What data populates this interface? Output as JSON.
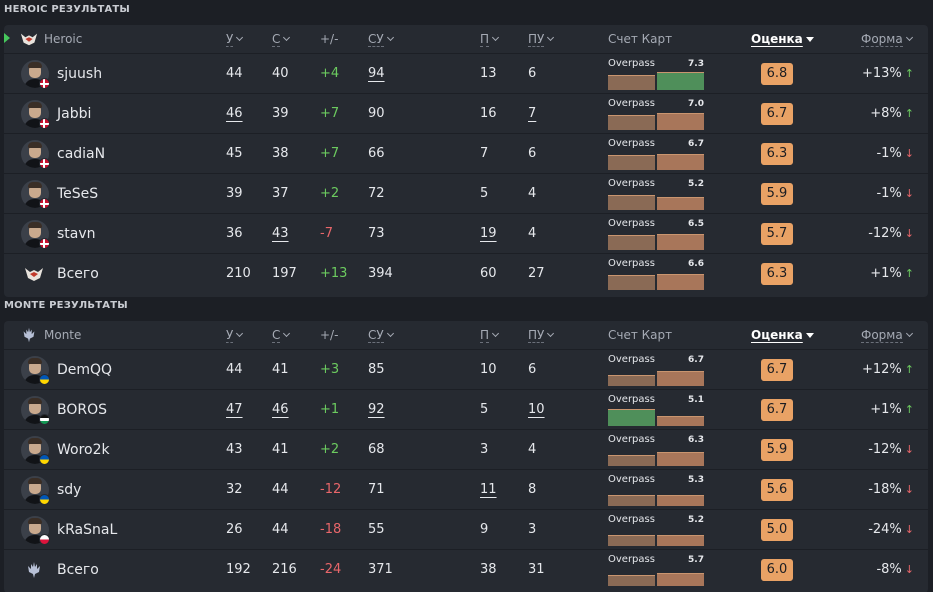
{
  "sections": [
    {
      "title": "HEROIC РЕЗУЛЬТАТЫ",
      "team": "Heroic",
      "team_logo_icon": "heroic-wings-icon",
      "team_logo_color": "#e8e3dd",
      "selected": true,
      "columns": {
        "kills": "У",
        "deaths": "С",
        "diff": "+/-",
        "adr": "СУ",
        "fk": "П",
        "fd": "ПУ",
        "map_score": "Счет Карт",
        "rating": "Оценка",
        "form": "Форма"
      },
      "rows": [
        {
          "name": "sjuush",
          "flag": "dk",
          "kills": "44",
          "deaths": "40",
          "diff": "+4",
          "adr": "94",
          "fk": "13",
          "fd": "6",
          "map": "Overpass",
          "map_rating": "7.3",
          "map_fill": 0.85,
          "map_rating_fill": 1.0,
          "map_highlight": true,
          "rating": "6.8",
          "form": "+13%",
          "trend": "up",
          "underline": [
            "adr"
          ]
        },
        {
          "name": "Jabbi",
          "flag": "dk",
          "kills": "46",
          "deaths": "39",
          "diff": "+7",
          "adr": "90",
          "fk": "16",
          "fd": "7",
          "map": "Overpass",
          "map_rating": "7.0",
          "map_fill": 0.85,
          "map_rating_fill": 0.95,
          "map_highlight": false,
          "rating": "6.7",
          "form": "+8%",
          "trend": "up",
          "underline": [
            "kills",
            "fd"
          ]
        },
        {
          "name": "cadiaN",
          "flag": "dk",
          "kills": "45",
          "deaths": "38",
          "diff": "+7",
          "adr": "66",
          "fk": "7",
          "fd": "6",
          "map": "Overpass",
          "map_rating": "6.7",
          "map_fill": 0.85,
          "map_rating_fill": 0.9,
          "map_highlight": false,
          "rating": "6.3",
          "form": "-1%",
          "trend": "down",
          "underline": []
        },
        {
          "name": "TeSeS",
          "flag": "dk",
          "kills": "39",
          "deaths": "37",
          "diff": "+2",
          "adr": "72",
          "fk": "5",
          "fd": "4",
          "map": "Overpass",
          "map_rating": "5.2",
          "map_fill": 0.85,
          "map_rating_fill": 0.7,
          "map_highlight": false,
          "rating": "5.9",
          "form": "-1%",
          "trend": "down",
          "underline": []
        },
        {
          "name": "stavn",
          "flag": "dk",
          "kills": "36",
          "deaths": "43",
          "diff": "-7",
          "adr": "73",
          "fk": "19",
          "fd": "4",
          "map": "Overpass",
          "map_rating": "6.5",
          "map_fill": 0.85,
          "map_rating_fill": 0.88,
          "map_highlight": false,
          "rating": "5.7",
          "form": "-12%",
          "trend": "down",
          "underline": [
            "deaths",
            "fk"
          ]
        },
        {
          "name": "Всего",
          "flag": "",
          "is_total": true,
          "kills": "210",
          "deaths": "197",
          "diff": "+13",
          "adr": "394",
          "fk": "60",
          "fd": "27",
          "map": "Overpass",
          "map_rating": "6.6",
          "map_fill": 0.85,
          "map_rating_fill": 0.89,
          "map_highlight": false,
          "rating": "6.3",
          "form": "+1%",
          "trend": "up",
          "underline": []
        }
      ]
    },
    {
      "title": "MONTE РЕЗУЛЬТАТЫ",
      "team": "Monte",
      "team_logo_icon": "monte-trident-icon",
      "team_logo_color": "#b7c0d6",
      "selected": false,
      "columns": {
        "kills": "У",
        "deaths": "С",
        "diff": "+/-",
        "adr": "СУ",
        "fk": "П",
        "fd": "ПУ",
        "map_score": "Счет Карт",
        "rating": "Оценка",
        "form": "Форма"
      },
      "rows": [
        {
          "name": "DemQQ",
          "flag": "ua",
          "kills": "44",
          "deaths": "41",
          "diff": "+3",
          "adr": "85",
          "fk": "10",
          "fd": "6",
          "map": "Overpass",
          "map_rating": "6.7",
          "map_fill": 0.6,
          "map_rating_fill": 0.85,
          "map_highlight": false,
          "rating": "6.7",
          "form": "+12%",
          "trend": "up",
          "underline": []
        },
        {
          "name": "BOROS",
          "flag": "ps",
          "kills": "47",
          "deaths": "46",
          "diff": "+1",
          "adr": "92",
          "fk": "5",
          "fd": "10",
          "map": "Overpass",
          "map_rating": "5.1",
          "map_fill": 0.95,
          "map_rating_fill": 0.55,
          "map_highlight": true,
          "rating": "6.7",
          "form": "+1%",
          "trend": "up",
          "underline": [
            "kills",
            "deaths",
            "adr",
            "fd"
          ]
        },
        {
          "name": "Woro2k",
          "flag": "ua",
          "kills": "43",
          "deaths": "41",
          "diff": "+2",
          "adr": "68",
          "fk": "3",
          "fd": "4",
          "map": "Overpass",
          "map_rating": "6.3",
          "map_fill": 0.6,
          "map_rating_fill": 0.8,
          "map_highlight": false,
          "rating": "5.9",
          "form": "-12%",
          "trend": "down",
          "underline": []
        },
        {
          "name": "sdy",
          "flag": "ua",
          "kills": "32",
          "deaths": "44",
          "diff": "-12",
          "adr": "71",
          "fk": "11",
          "fd": "8",
          "map": "Overpass",
          "map_rating": "5.3",
          "map_fill": 0.6,
          "map_rating_fill": 0.62,
          "map_highlight": false,
          "rating": "5.6",
          "form": "-18%",
          "trend": "down",
          "underline": [
            "fk"
          ]
        },
        {
          "name": "kRaSnaL",
          "flag": "pl",
          "kills": "26",
          "deaths": "44",
          "diff": "-18",
          "adr": "55",
          "fk": "9",
          "fd": "3",
          "map": "Overpass",
          "map_rating": "5.2",
          "map_fill": 0.6,
          "map_rating_fill": 0.6,
          "map_highlight": false,
          "rating": "5.0",
          "form": "-24%",
          "trend": "down",
          "underline": []
        },
        {
          "name": "Всего",
          "flag": "",
          "is_total": true,
          "kills": "192",
          "deaths": "216",
          "diff": "-24",
          "adr": "371",
          "fk": "38",
          "fd": "31",
          "map": "Overpass",
          "map_rating": "5.7",
          "map_fill": 0.6,
          "map_rating_fill": 0.72,
          "map_highlight": false,
          "rating": "6.0",
          "form": "-8%",
          "trend": "down",
          "underline": []
        }
      ]
    }
  ],
  "colors": {
    "bar": "#a8765a",
    "bar_highlight": "#4f8f5a",
    "bar_dim": "#8a6a55",
    "rating_box": "#e9a265",
    "positive": "#6ccb5f",
    "negative": "#e8666a"
  }
}
